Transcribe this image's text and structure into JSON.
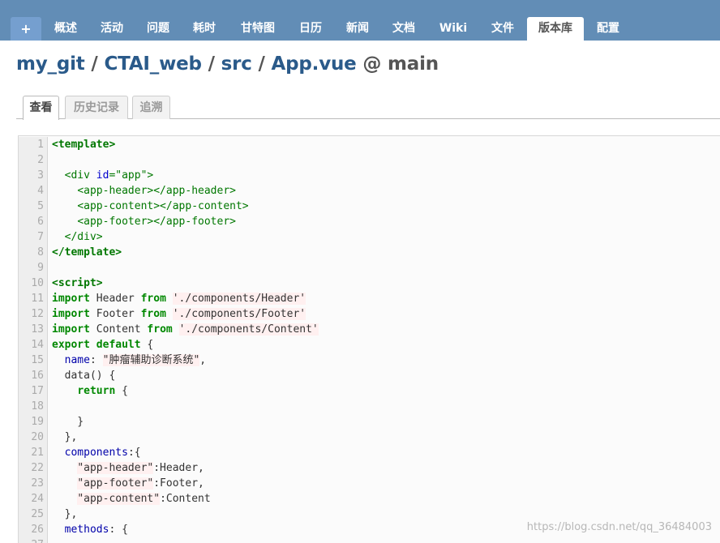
{
  "topnav": {
    "tabs": [
      {
        "label": "+"
      },
      {
        "label": "概述"
      },
      {
        "label": "活动"
      },
      {
        "label": "问题"
      },
      {
        "label": "耗时"
      },
      {
        "label": "甘特图"
      },
      {
        "label": "日历"
      },
      {
        "label": "新闻"
      },
      {
        "label": "文档"
      },
      {
        "label": "Wiki"
      },
      {
        "label": "文件"
      },
      {
        "label": "版本库"
      },
      {
        "label": "配置"
      }
    ],
    "selected": "版本库"
  },
  "breadcrumb": {
    "project": "my_git",
    "repo": "CTAI_web",
    "dir": "src",
    "file": "App.vue",
    "at": "@",
    "branch": "main",
    "separator": "/"
  },
  "content_tabs": [
    {
      "label": "查看"
    },
    {
      "label": "历史记录"
    },
    {
      "label": "追溯"
    }
  ],
  "code": {
    "lines": [
      [
        {
          "t": "<template>",
          "c": "tag-bold"
        }
      ],
      [],
      [
        {
          "t": "  "
        },
        {
          "t": "<div",
          "c": "tag"
        },
        {
          "t": " "
        },
        {
          "t": "id",
          "c": "attr"
        },
        {
          "t": "=\"app\">",
          "c": "tag"
        }
      ],
      [
        {
          "t": "    "
        },
        {
          "t": "<app-header></app-header>",
          "c": "tag"
        }
      ],
      [
        {
          "t": "    "
        },
        {
          "t": "<app-content></app-content>",
          "c": "tag"
        }
      ],
      [
        {
          "t": "    "
        },
        {
          "t": "<app-footer></app-footer>",
          "c": "tag"
        }
      ],
      [
        {
          "t": "  "
        },
        {
          "t": "</div>",
          "c": "tag"
        }
      ],
      [
        {
          "t": "</template>",
          "c": "tag-bold"
        }
      ],
      [],
      [
        {
          "t": "<script>",
          "c": "tag-bold"
        }
      ],
      [
        {
          "t": "import",
          "c": "kw"
        },
        {
          "t": " Header "
        },
        {
          "t": "from",
          "c": "kw"
        },
        {
          "t": " "
        },
        {
          "t": "'./components/Header'",
          "c": "str"
        }
      ],
      [
        {
          "t": "import",
          "c": "kw"
        },
        {
          "t": " Footer "
        },
        {
          "t": "from",
          "c": "kw"
        },
        {
          "t": " "
        },
        {
          "t": "'./components/Footer'",
          "c": "str"
        }
      ],
      [
        {
          "t": "import",
          "c": "kw"
        },
        {
          "t": " Content "
        },
        {
          "t": "from",
          "c": "kw"
        },
        {
          "t": " "
        },
        {
          "t": "'./components/Content'",
          "c": "str"
        }
      ],
      [
        {
          "t": "export",
          "c": "kw"
        },
        {
          "t": " "
        },
        {
          "t": "default",
          "c": "kw"
        },
        {
          "t": " {"
        }
      ],
      [
        {
          "t": "  "
        },
        {
          "t": "name",
          "c": "prop"
        },
        {
          "t": ": "
        },
        {
          "t": "\"肿瘤辅助诊断系统\"",
          "c": "str"
        },
        {
          "t": ","
        }
      ],
      [
        {
          "t": "  data() {"
        }
      ],
      [
        {
          "t": "    "
        },
        {
          "t": "return",
          "c": "kw"
        },
        {
          "t": " {"
        }
      ],
      [],
      [
        {
          "t": "    }"
        }
      ],
      [
        {
          "t": "  },"
        }
      ],
      [
        {
          "t": "  "
        },
        {
          "t": "components",
          "c": "prop"
        },
        {
          "t": ":{"
        }
      ],
      [
        {
          "t": "    "
        },
        {
          "t": "\"app-header\"",
          "c": "str"
        },
        {
          "t": ":Header,"
        }
      ],
      [
        {
          "t": "    "
        },
        {
          "t": "\"app-footer\"",
          "c": "str"
        },
        {
          "t": ":Footer,"
        }
      ],
      [
        {
          "t": "    "
        },
        {
          "t": "\"app-content\"",
          "c": "str"
        },
        {
          "t": ":Content"
        }
      ],
      [
        {
          "t": "  },"
        }
      ],
      [
        {
          "t": "  "
        },
        {
          "t": "methods",
          "c": "prop"
        },
        {
          "t": ": {"
        }
      ],
      []
    ]
  },
  "watermark": "https://blog.csdn.net/qq_36484003",
  "colors": {
    "nav_bg": "#628db6",
    "link": "#2a5a8a"
  }
}
